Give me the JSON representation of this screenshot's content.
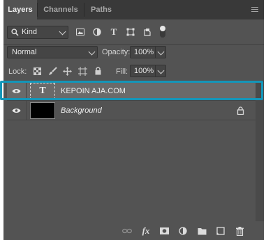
{
  "tabs": [
    {
      "label": "Layers",
      "active": true
    },
    {
      "label": "Channels",
      "active": false
    },
    {
      "label": "Paths",
      "active": false
    }
  ],
  "filter": {
    "kind_label": "Kind",
    "icons": [
      "image-filter-icon",
      "adjustment-filter-icon",
      "type-filter-icon",
      "shape-filter-icon",
      "smart-object-filter-icon",
      "filter-toggle-icon"
    ]
  },
  "blend": {
    "mode": "Normal",
    "opacity_label": "Opacity:",
    "opacity_value": "100%"
  },
  "lock": {
    "label": "Lock:",
    "fill_label": "Fill:",
    "fill_value": "100%"
  },
  "layers": [
    {
      "name": "KEPOIN AJA.COM",
      "type": "text",
      "thumb_glyph": "T",
      "selected": true,
      "locked": false
    },
    {
      "name": "Background",
      "type": "background",
      "selected": false,
      "locked": true
    }
  ],
  "footer": {
    "fx_label": "fx"
  },
  "colors": {
    "panel": "#535353",
    "tabbar": "#393939",
    "highlight": "#1396b9",
    "selected_row": "#6a6a6a"
  }
}
